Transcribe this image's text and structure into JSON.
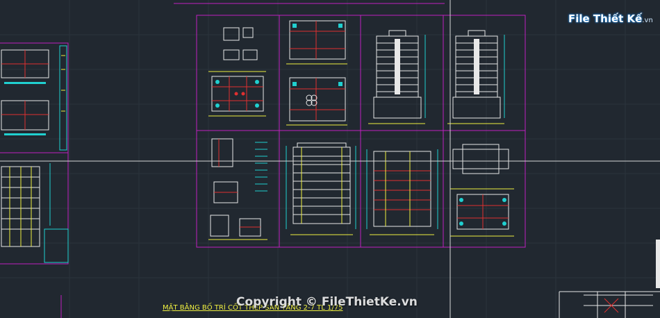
{
  "logo": {
    "brand": "File Thiết Kế",
    "suffix": ".vn"
  },
  "watermark": {
    "text": "Copyright © FileThietKe.vn"
  },
  "plan_title": {
    "text": "MẶT BẰNG BỐ TRÍ CỐT THÉP SÀN TẦNG 2-7 TL 1/75"
  },
  "colors": {
    "background": "#212830",
    "sheet_border": "#c020c0",
    "crosshair": "#d8d8d8",
    "cyan": "#20d0d0",
    "yellow": "#f0f040",
    "red": "#e03030",
    "white": "#e8e8e8"
  }
}
